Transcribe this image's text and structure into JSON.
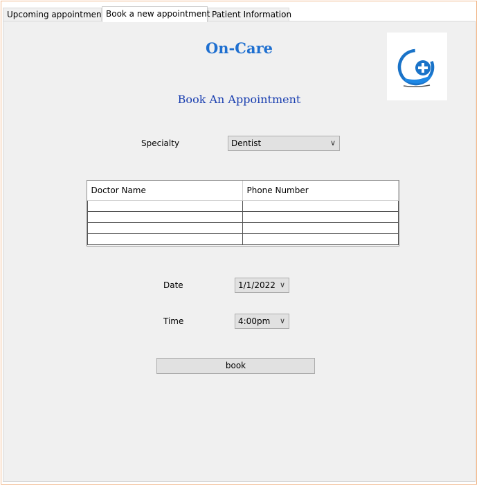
{
  "tabs": [
    {
      "label": "Upcoming appointment"
    },
    {
      "label": "Book a new appointment"
    },
    {
      "label": "Patient Information"
    }
  ],
  "header": {
    "app_title": "On-Care",
    "subtitle": "Book An Appointment"
  },
  "form": {
    "specialty_label": "Specialty",
    "specialty_value": "Dentist",
    "date_label": "Date",
    "date_value": "1/1/2022",
    "time_label": "Time",
    "time_value": "4:00pm",
    "book_label": "book"
  },
  "table": {
    "columns": [
      "Doctor Name",
      "Phone Number"
    ]
  },
  "colors": {
    "title": "#1e6fd0",
    "subtitle": "#1a3fb0",
    "logo_blue": "#1a73c8"
  },
  "icons": {
    "logo": "medical-cross-hand-logo",
    "dropdown": "chevron-down-icon"
  }
}
